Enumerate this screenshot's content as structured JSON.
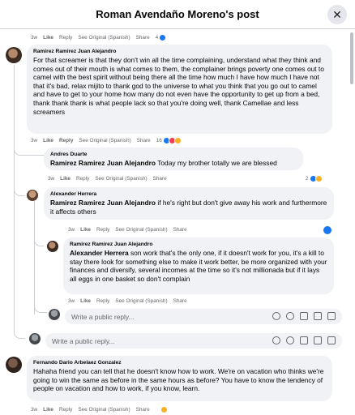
{
  "header": {
    "title": "Roman Avendaño Moreno's post",
    "close_glyph": "✕"
  },
  "colors": {
    "accent": "#1877f2",
    "bubble": "#f0f2f5",
    "muted": "#65676b"
  },
  "top_meta": {
    "time": "3w",
    "like": "Like",
    "reply": "Reply",
    "see_original": "See Original (Spanish)",
    "share": "Share",
    "reaction_count": "4"
  },
  "comments": [
    {
      "author": "Ramirez Ramirez Juan Alejandro",
      "text": "For that screamer is that they don't win all the time complaining, understand what they think and comes out of their mouth is what comes to them, the complainer brings poverty one comes out to camel with the best spirit without being there all the time how much I have how much I have not that it's bad, relax mijito to thank god to the universe to what you think that you go out to camel and have to get to your home how many do not even have the opportunity to get up from a bed, thank thank thank is what people lack so that you're doing well, thank Camellae and less screamers",
      "meta": {
        "time": "3w",
        "like": "Like",
        "reply": "Reply",
        "see_original": "See Original (Spanish)",
        "share": "Share",
        "reaction_count": "16"
      }
    },
    {
      "author": "Andres Duarte",
      "tag": "Ramirez Ramirez Juan Alejandro",
      "text": " Today my brother totally we are blessed",
      "meta": {
        "time": "3w",
        "like": "Like",
        "reply": "Reply",
        "see_original": "See Original (Spanish)",
        "share": "Share",
        "reaction_count": "2"
      }
    },
    {
      "author": "Alexander Herrera",
      "tag": "Ramirez Ramirez Juan Alejandro",
      "text": " if he's right but don't give away his work and furthermore it affects others",
      "meta": {
        "time": "3w",
        "like": "Like",
        "reply": "Reply",
        "see_original": "See Original (Spanish)",
        "share": "Share"
      }
    },
    {
      "author": "Ramirez Ramirez Juan Alejandro",
      "tag": "Alexander Herrera",
      "text": " son work that's the only one, if it doesn't work for you, it's a kill to stay there look for something else to make it work better, be more organized with your finances and diversify, several incomes at the time so it's not millionada but if it lays all eggs in one basket so don't complain",
      "meta": {
        "time": "3w",
        "like": "Like",
        "reply": "Reply",
        "see_original": "See Original (Spanish)",
        "share": "Share"
      }
    },
    {
      "author": "Fernando Dario Arbelaez Gonzalez",
      "text": "Hahaha friend you can tell that he doesn't know how to work. We're on vacation who thinks we're going to win the same as before in the same hours as before? You have to know the tendency of people on vacation and how to work, if you know, learn.",
      "meta": {
        "time": "3w",
        "like": "Like",
        "reply": "Reply",
        "see_original": "See Original (Spanish)",
        "share": "Share"
      }
    }
  ],
  "reply_input": {
    "placeholder": "Write a public reply..."
  },
  "input_icons": [
    "sticker-icon",
    "emoji-icon",
    "camera-icon",
    "gif-icon",
    "avatar-sticker-icon"
  ]
}
